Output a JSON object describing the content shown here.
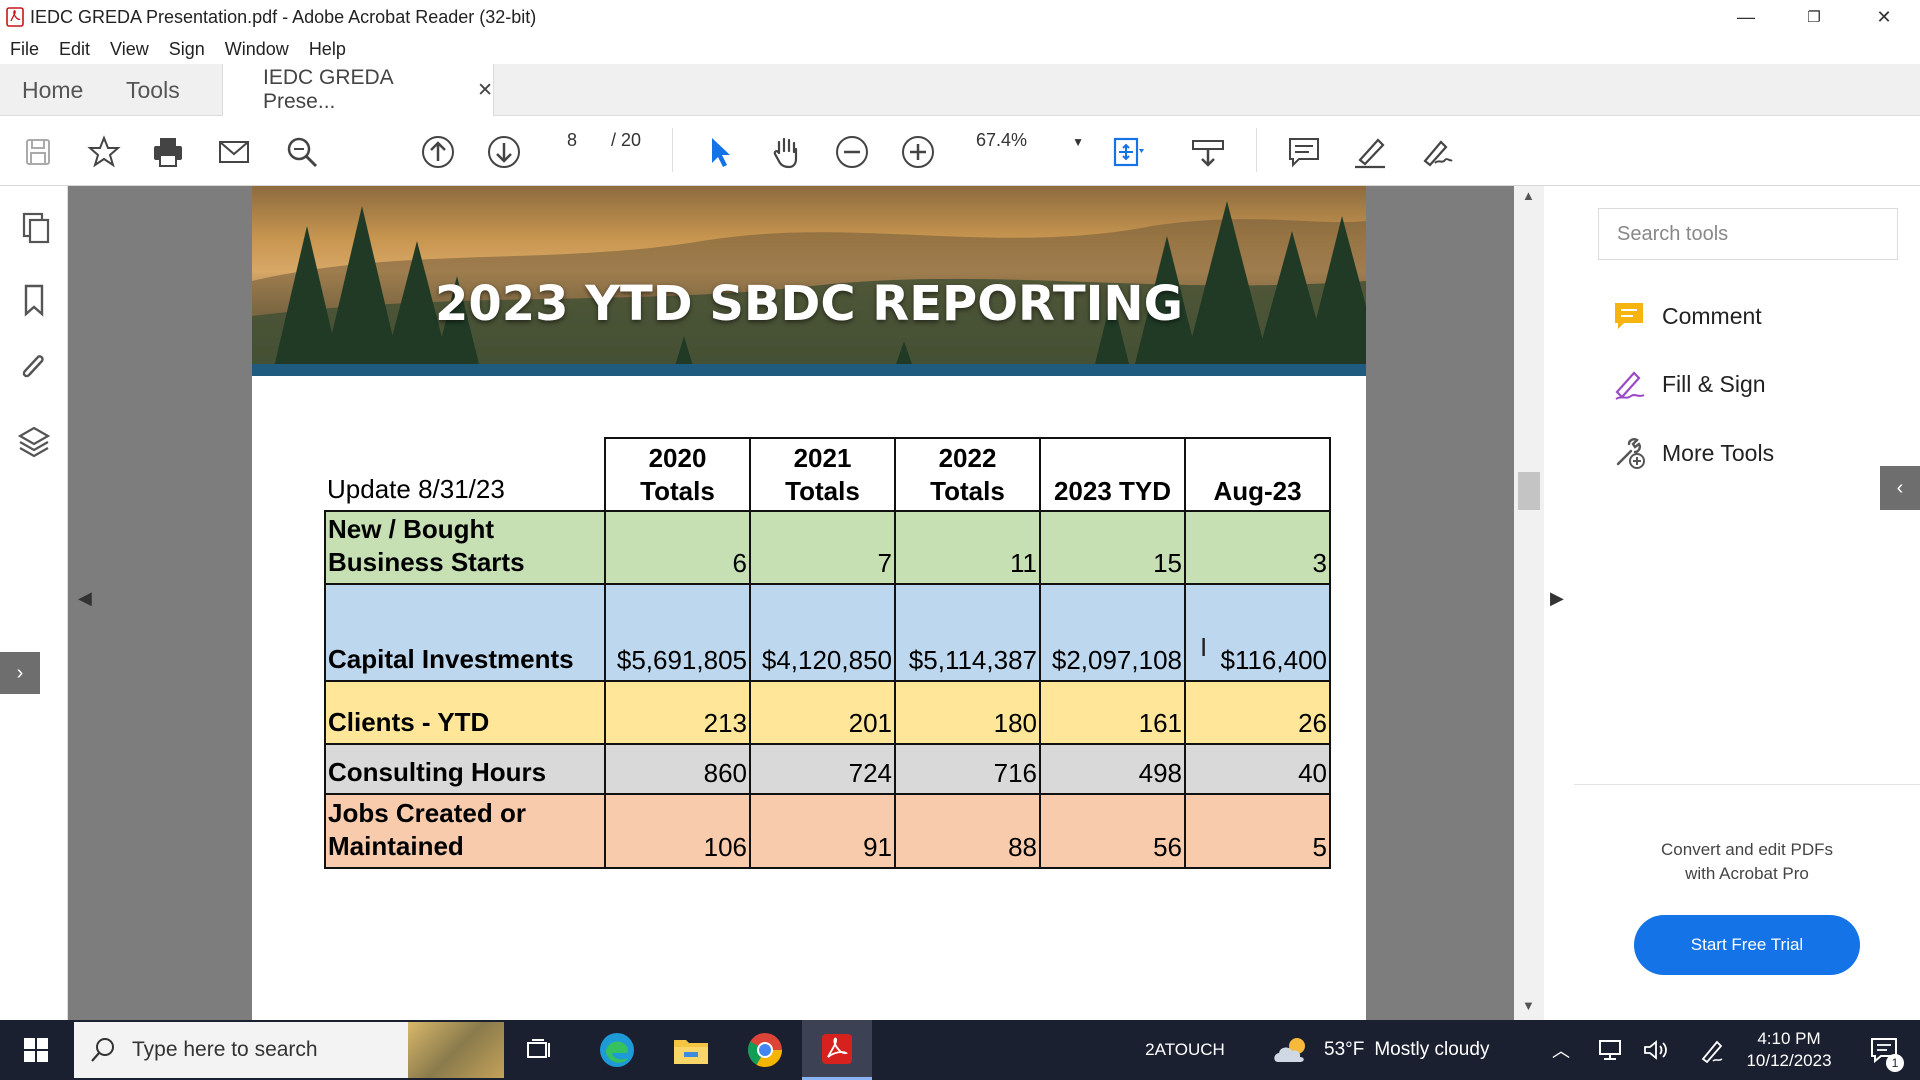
{
  "window": {
    "title": "IEDC GREDA Presentation.pdf - Adobe Acrobat Reader (32-bit)",
    "minimize": "—",
    "restore": "❐",
    "close": "✕"
  },
  "menu": [
    "File",
    "Edit",
    "View",
    "Sign",
    "Window",
    "Help"
  ],
  "tabs": {
    "home": "Home",
    "tools": "Tools",
    "doc": "IEDC GREDA Prese...",
    "doc_close": "✕"
  },
  "toolbar": {
    "page_current": "8",
    "page_total": "/ 20",
    "zoom": "67.4%"
  },
  "document": {
    "banner_title": "2023 YTD SBDC REPORTING",
    "table": {
      "update_label": "Update 8/31/23",
      "headers": [
        [
          "2020",
          "Totals"
        ],
        [
          "2021",
          "Totals"
        ],
        [
          "2022",
          "Totals"
        ],
        [
          "2023 TYD"
        ],
        [
          "Aug-23"
        ]
      ],
      "rows": [
        {
          "label": [
            "New / Bought",
            "Business Starts"
          ],
          "values": [
            "6",
            "7",
            "11",
            "15",
            "3"
          ],
          "color": "#c6e0b4"
        },
        {
          "label": [
            "Capital Investments"
          ],
          "values": [
            "$5,691,805",
            "$4,120,850",
            "$5,114,387",
            "$2,097,108",
            "$116,400"
          ],
          "color": "#bdd7ee"
        },
        {
          "label": [
            "Clients - YTD"
          ],
          "values": [
            "213",
            "201",
            "180",
            "161",
            "26"
          ],
          "color": "#ffe699"
        },
        {
          "label": [
            "Consulting Hours"
          ],
          "values": [
            "860",
            "724",
            "716",
            "498",
            "40"
          ],
          "color": "#d9d9d9"
        },
        {
          "label": [
            "Jobs Created or",
            "Maintained"
          ],
          "values": [
            "106",
            "91",
            "88",
            "56",
            "5"
          ],
          "color": "#f8cbad"
        }
      ]
    }
  },
  "right_pane": {
    "search_placeholder": "Search tools",
    "tools": [
      "Comment",
      "Fill & Sign",
      "More Tools"
    ],
    "promo_line1": "Convert and edit PDFs",
    "promo_line2": "with Acrobat Pro",
    "trial_button": "Start Free Trial"
  },
  "taskbar": {
    "search_placeholder": "Type here to search",
    "touch_label": "2ATOUCH",
    "weather_temp": "53°F",
    "weather_desc": "Mostly cloudy",
    "time": "4:10 PM",
    "date": "10/12/2023",
    "notification_count": "1"
  }
}
